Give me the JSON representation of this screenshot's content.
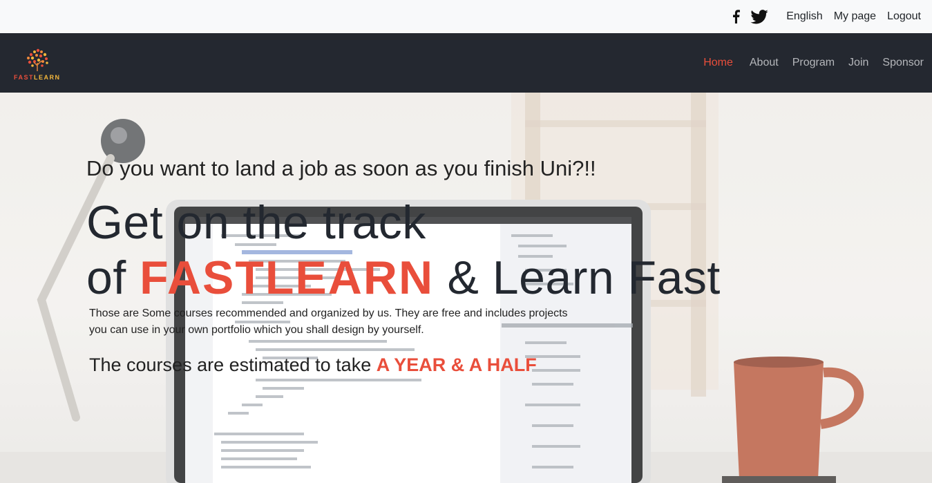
{
  "topbar": {
    "social": [
      "facebook-icon",
      "twitter-icon"
    ],
    "language": "English",
    "my_page": "My page",
    "logout": "Logout"
  },
  "brand": {
    "name_part1": "FAST",
    "name_part2": "LEARN"
  },
  "nav": {
    "items": [
      {
        "label": "Home",
        "active": true
      },
      {
        "label": "About"
      },
      {
        "label": "Program"
      },
      {
        "label": "Join"
      },
      {
        "label": "Sponsor"
      }
    ]
  },
  "hero": {
    "tagline": "Do you want to land a job as soon as you finish Uni?!!",
    "headline_line1": "Get on the track",
    "headline_of": "of ",
    "headline_brand": "FASTLEARN",
    "headline_rest": " & Learn Fast",
    "description": "Those are Some courses recommended and organized by us. They are free and includes projects you can use in your own portfolio which you shall design by yourself.",
    "duration_prefix": "The courses are estimated to take ",
    "duration_highlight": "A YEAR & A HALF"
  },
  "colors": {
    "accent": "#e94e3b",
    "nav_bg": "#242830",
    "topbar_bg": "#f8f9fa",
    "text_dark": "#232830"
  }
}
